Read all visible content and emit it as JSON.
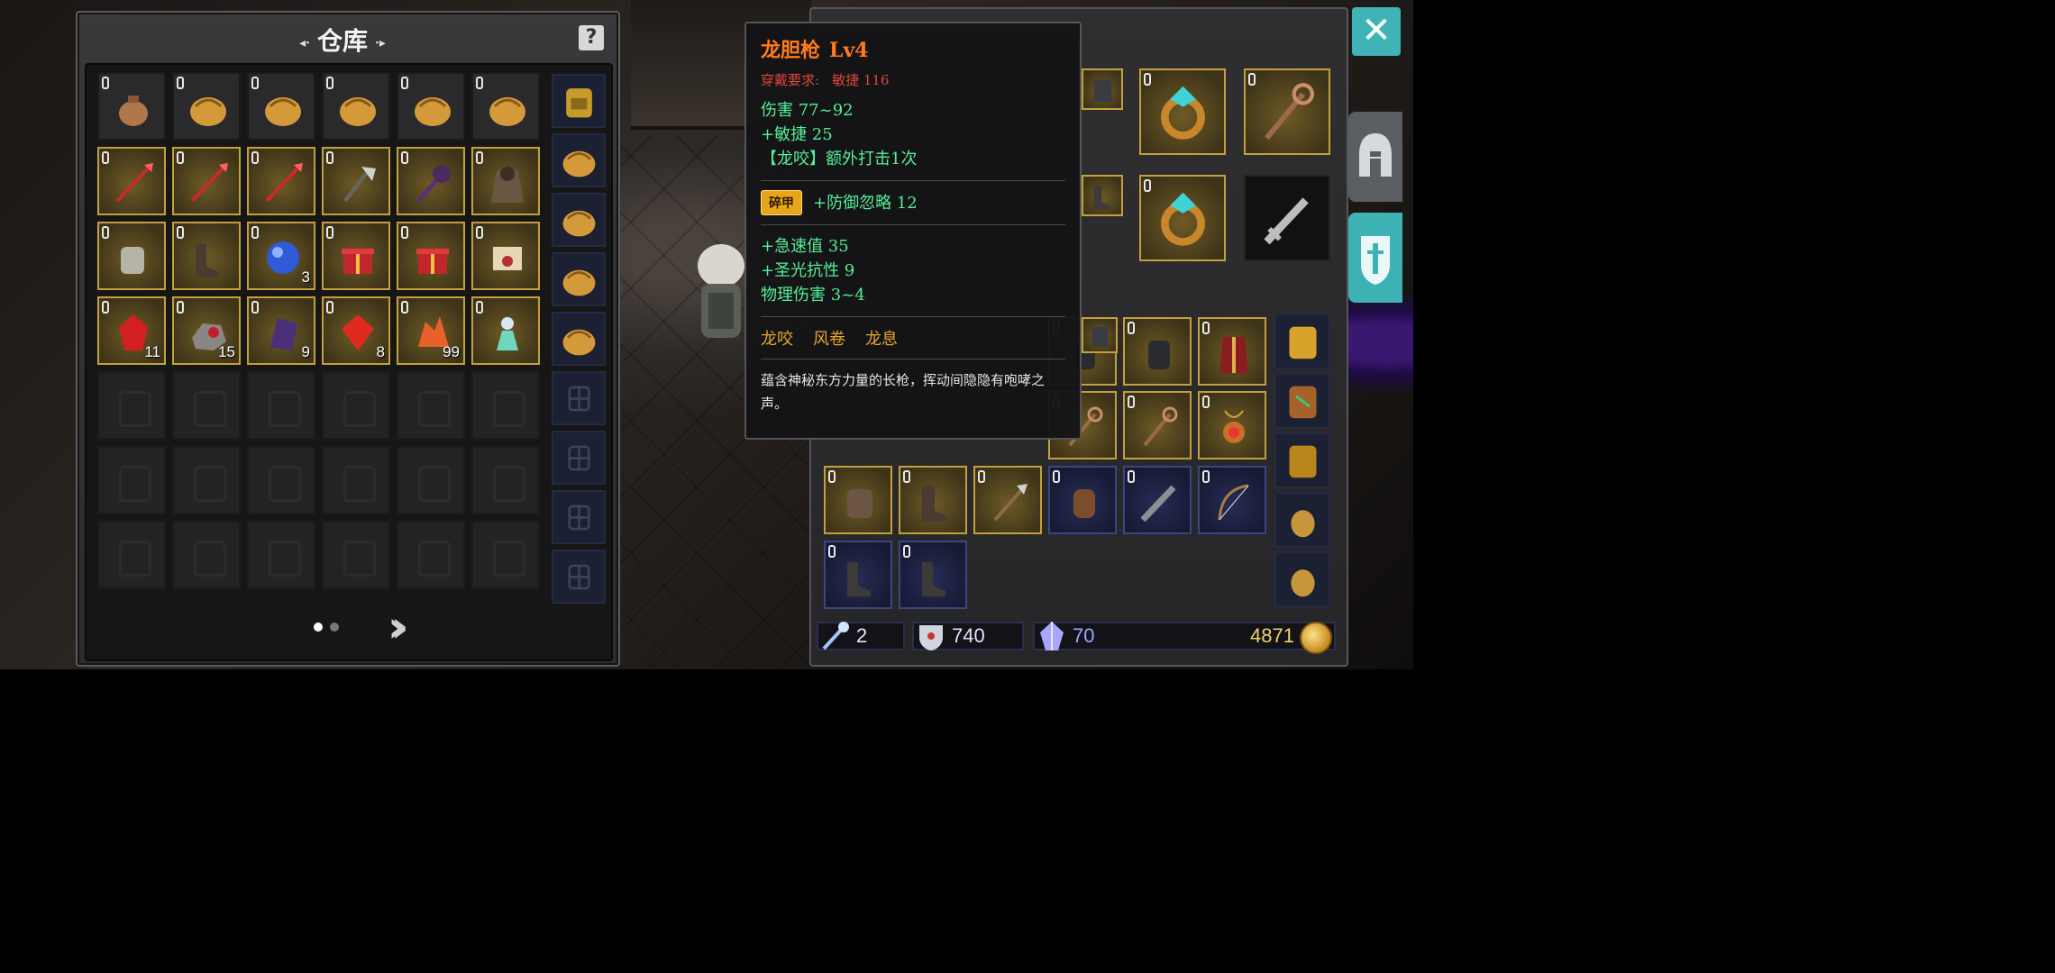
{
  "warehouse": {
    "title": "仓库",
    "help_label": "?",
    "grid": [
      [
        {
          "item": "coin-pouch",
          "frame": "plain",
          "qty": ""
        },
        {
          "item": "leather-bag",
          "frame": "plain",
          "qty": ""
        },
        {
          "item": "leather-bag",
          "frame": "plain",
          "qty": ""
        },
        {
          "item": "leather-bag",
          "frame": "plain",
          "qty": ""
        },
        {
          "item": "leather-bag",
          "frame": "plain",
          "qty": ""
        },
        {
          "item": "leather-bag",
          "frame": "plain",
          "qty": ""
        }
      ],
      [
        {
          "item": "red-spear",
          "frame": "gold",
          "qty": ""
        },
        {
          "item": "red-spear",
          "frame": "gold",
          "qty": ""
        },
        {
          "item": "red-spear",
          "frame": "gold",
          "qty": ""
        },
        {
          "item": "battle-axe",
          "frame": "gold",
          "qty": ""
        },
        {
          "item": "dark-staff",
          "frame": "gold",
          "qty": ""
        },
        {
          "item": "hooded-robe",
          "frame": "gold",
          "qty": ""
        }
      ],
      [
        {
          "item": "steel-gauntlet",
          "frame": "gold",
          "qty": ""
        },
        {
          "item": "leather-boots",
          "frame": "gold",
          "qty": ""
        },
        {
          "item": "blue-orb",
          "frame": "gold",
          "qty": "3"
        },
        {
          "item": "gift-box",
          "frame": "gold",
          "qty": ""
        },
        {
          "item": "gift-box",
          "frame": "gold",
          "qty": ""
        },
        {
          "item": "sealed-letter",
          "frame": "gold",
          "qty": ""
        }
      ],
      [
        {
          "item": "red-crystal",
          "frame": "gold",
          "qty": "11"
        },
        {
          "item": "ore-chunk",
          "frame": "gold",
          "qty": "15"
        },
        {
          "item": "purple-shard",
          "frame": "gold",
          "qty": "9"
        },
        {
          "item": "red-gem",
          "frame": "gold",
          "qty": "8"
        },
        {
          "item": "orange-crystal",
          "frame": "gold",
          "qty": "99"
        },
        {
          "item": "spirit-figure",
          "frame": "gold",
          "qty": ""
        }
      ]
    ],
    "empty_rows": 3,
    "bag_column": [
      "backpack",
      "leather-bag",
      "leather-bag",
      "leather-bag",
      "leather-bag",
      "locked",
      "locked",
      "locked",
      "locked"
    ],
    "pager": {
      "pages": 2,
      "current": 1,
      "next_label": "»"
    }
  },
  "tooltip": {
    "name": "龙胆枪",
    "level": "Lv4",
    "requirement_label": "穿戴要求:",
    "requirement_value": "敏捷 116",
    "base_stats": [
      "伤害 77~92",
      "+敏捷 25",
      "【龙咬】额外打击1次"
    ],
    "gem_badge": "碎甲",
    "gem_stat": "+防御忽略 12",
    "extra_stats": [
      "+急速值 35",
      "+圣光抗性 9",
      "物理伤害 3~4"
    ],
    "skills": [
      "龙咬",
      "风卷",
      "龙息"
    ],
    "description": "蕴含神秘东方力量的长枪，挥动间隐隐有咆哮之声。"
  },
  "character": {
    "close_label": "✕",
    "tabs": [
      "helmet-tab",
      "armor-tab"
    ],
    "equipped": [
      "amethyst-ring",
      "amethyst-ring",
      "serpent-staff",
      "amethyst-ring",
      "sword-placeholder"
    ],
    "backpack": [
      [
        {
          "item": "dark-armor",
          "frame": "gold"
        },
        {
          "item": "iron-gauntlet",
          "frame": "gold"
        },
        {
          "item": "iron-gauntlet",
          "frame": "gold"
        },
        {
          "item": "crimson-robe",
          "frame": "gold"
        }
      ],
      [
        {
          "item": "serpent-staff",
          "frame": "gold"
        },
        {
          "item": "serpent-staff",
          "frame": "gold"
        },
        {
          "item": "fire-amulet",
          "frame": "gold"
        }
      ],
      [
        {
          "item": "plate-gauntlet",
          "frame": "gold"
        },
        {
          "item": "iron-boots",
          "frame": "gold"
        },
        {
          "item": "halberd",
          "frame": "gold"
        },
        {
          "item": "cloth-glove",
          "frame": "blue"
        },
        {
          "item": "greatsword",
          "frame": "blue"
        },
        {
          "item": "longbow",
          "frame": "blue"
        }
      ],
      [
        {
          "item": "cloth-boots",
          "frame": "blue"
        },
        {
          "item": "cloth-boots",
          "frame": "blue"
        }
      ]
    ],
    "bags": [
      "golden-backpack",
      "leaf-backpack",
      "gold-backpack",
      "small-sack",
      "small-sack"
    ]
  },
  "currency": {
    "enhance": "2",
    "shield": "740",
    "crystal": "70",
    "gold": "4871"
  },
  "colors": {
    "accent": "#3fb3b6",
    "rarity_gold": "#c4a03c",
    "rarity_blue": "#3b4582",
    "name_orange": "#ff7a1a",
    "stat_green": "#54ef96",
    "req_red": "#e0463c"
  }
}
